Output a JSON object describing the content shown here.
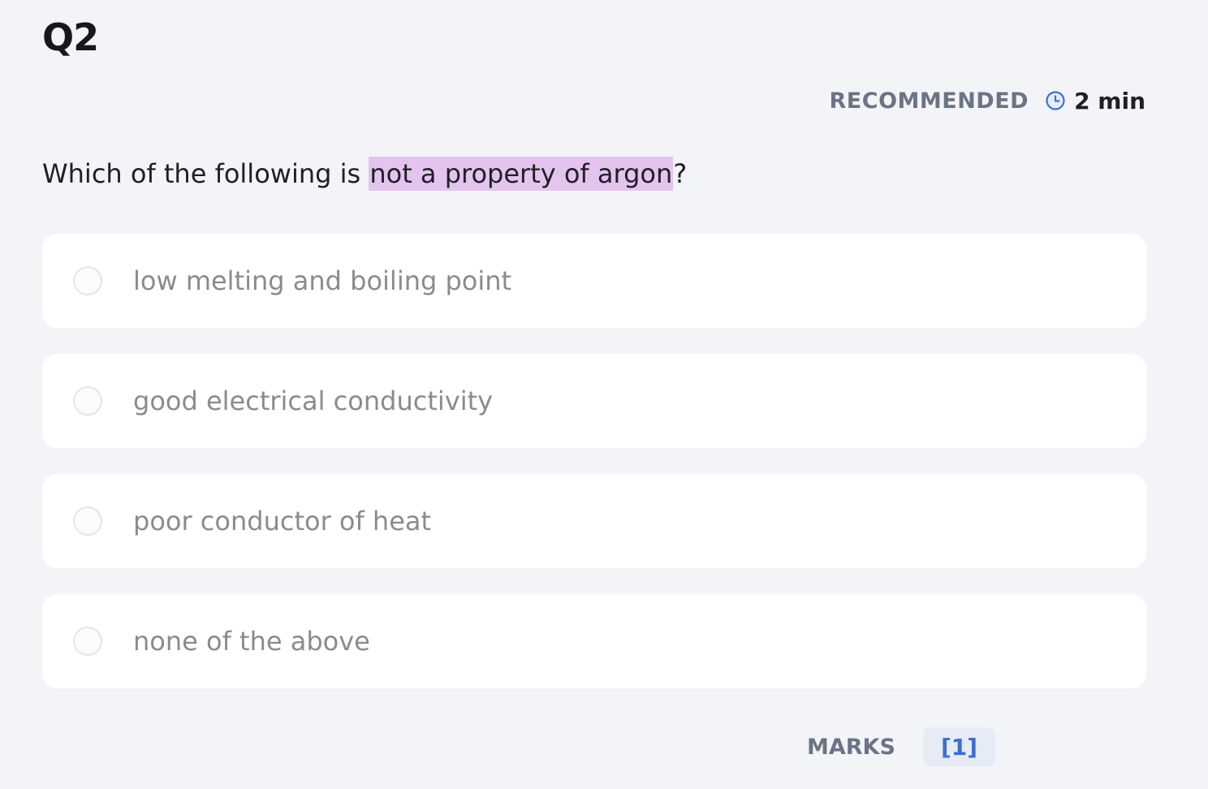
{
  "question": {
    "number": "Q2",
    "text_before": "Which of the following is ",
    "highlighted": "not a property of argon",
    "text_after": "?"
  },
  "recommended": {
    "label": "RECOMMENDED",
    "icon": "clock-icon",
    "time": "2 min"
  },
  "options": [
    {
      "label": "low melting and boiling point"
    },
    {
      "label": "good electrical conductivity"
    },
    {
      "label": "poor conductor of heat"
    },
    {
      "label": "none of the above"
    }
  ],
  "marks": {
    "label": "MARKS",
    "value": "[1]"
  },
  "colors": {
    "background": "#f3f4f8",
    "highlight": "#e4c4ef",
    "accent": "#3d6fd1"
  }
}
